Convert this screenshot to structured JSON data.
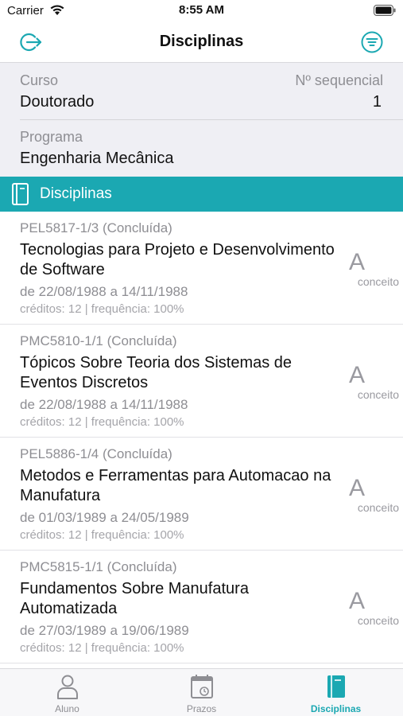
{
  "status_bar": {
    "carrier": "Carrier",
    "time": "8:55 AM"
  },
  "nav": {
    "title": "Disciplinas",
    "left_icon": "logout-icon",
    "right_icon": "filter-icon"
  },
  "info": {
    "curso_label": "Curso",
    "curso_value": "Doutorado",
    "sequencial_label": "Nº sequencial",
    "sequencial_value": "1",
    "programa_label": "Programa",
    "programa_value": "Engenharia Mecânica"
  },
  "section": {
    "title": "Disciplinas",
    "icon": "book-icon"
  },
  "courses": [
    {
      "code": "PEL5817-1/3 (Concluída)",
      "name": "Tecnologias para Projeto e Desenvolvimento de Software",
      "dates": "de 22/08/1988 a 14/11/1988",
      "credits": "créditos: 12 | frequência: 100%",
      "grade": "A",
      "grade_label": "conceito"
    },
    {
      "code": "PMC5810-1/1 (Concluída)",
      "name": "Tópicos Sobre Teoria dos Sistemas de Eventos Discretos",
      "dates": "de 22/08/1988 a 14/11/1988",
      "credits": "créditos: 12 | frequência: 100%",
      "grade": "A",
      "grade_label": "conceito"
    },
    {
      "code": "PEL5886-1/4 (Concluída)",
      "name": "Metodos e Ferramentas para Automacao na Manufatura",
      "dates": "de 01/03/1989 a 24/05/1989",
      "credits": "créditos: 12 | frequência: 100%",
      "grade": "A",
      "grade_label": "conceito"
    },
    {
      "code": "PMC5815-1/1 (Concluída)",
      "name": "Fundamentos Sobre Manufatura Automatizada",
      "dates": "de 27/03/1989 a 19/06/1989",
      "credits": "créditos: 12 | frequência: 100%",
      "grade": "A",
      "grade_label": "conceito"
    }
  ],
  "tabs": [
    {
      "label": "Aluno",
      "icon": "person-icon"
    },
    {
      "label": "Prazos",
      "icon": "calendar-icon"
    },
    {
      "label": "Disciplinas",
      "icon": "book-icon",
      "active": true
    }
  ],
  "colors": {
    "accent": "#1ba8b2",
    "info_background": "#efeff4"
  }
}
